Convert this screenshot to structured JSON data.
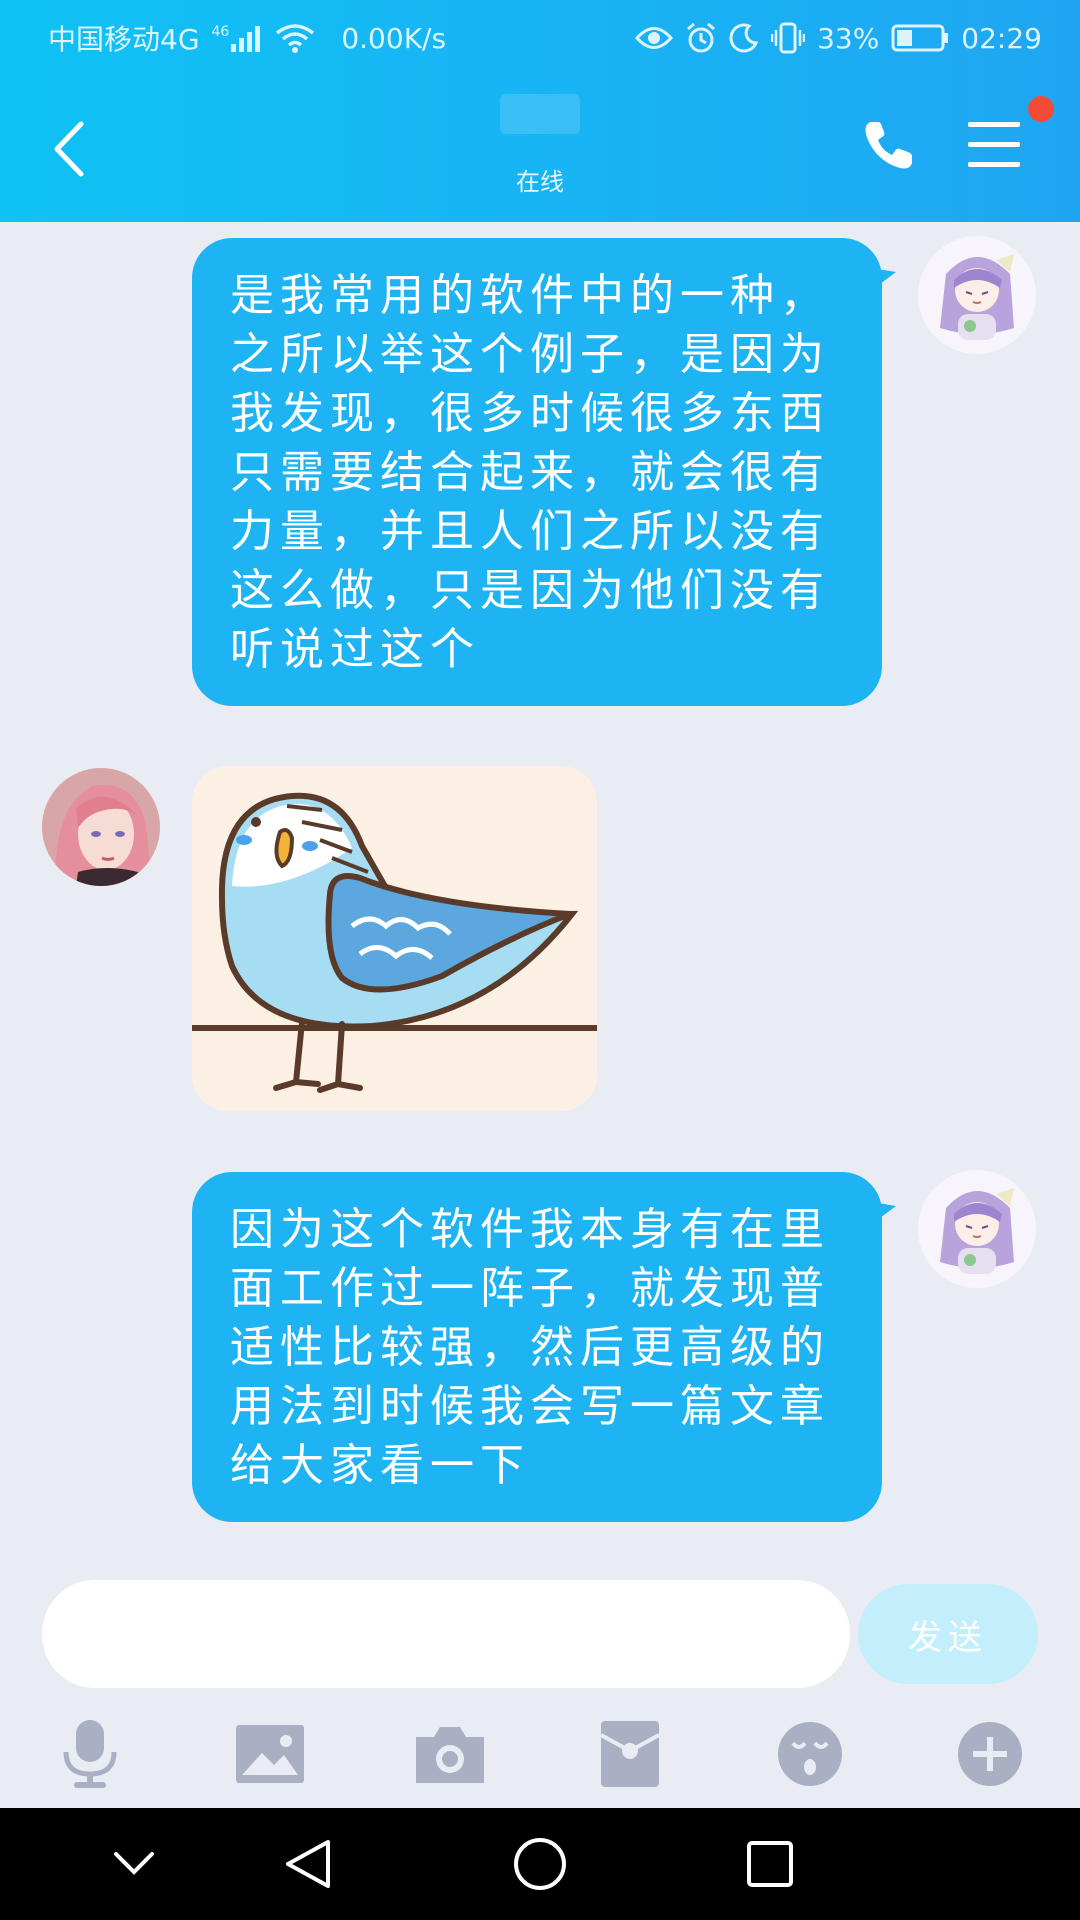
{
  "status_bar": {
    "carrier": "中国移动4G",
    "network_badge": "46",
    "speed": "0.00K/s",
    "battery_percent": "33%",
    "time": "02:29",
    "icons": [
      "signal-icon",
      "wifi-icon",
      "eye-icon",
      "alarm-icon",
      "moon-icon",
      "vibrate-icon",
      "battery-icon"
    ]
  },
  "header": {
    "contact_status": "在线",
    "icons": [
      "back-icon",
      "phone-icon",
      "menu-icon"
    ],
    "has_notification": true
  },
  "messages": [
    {
      "side": "right",
      "type": "text",
      "text": "是我常用的软件中的一种，\n之所以举这个例子，是因为\n我发现，很多时候很多东西\n只需要结合起来，就会很有\n力量，并且人们之所以没有\n这么做，只是因为他们没有\n听说过这个"
    },
    {
      "side": "left",
      "type": "sticker",
      "sticker": "blue-parakeet-sticker"
    },
    {
      "side": "right",
      "type": "text",
      "text": "因为这个软件我本身有在里\n面工作过一阵子，就发现普\n适性比较强，然后更高级的\n用法到时候我会写一篇文章\n给大家看一下"
    }
  ],
  "composer": {
    "input_value": "",
    "send_label": "发送"
  },
  "toolbar": {
    "icons": [
      "microphone-icon",
      "image-icon",
      "camera-icon",
      "red-packet-icon",
      "emoji-icon",
      "plus-icon"
    ]
  },
  "nav_bar": {
    "icons": [
      "chevron-down-icon",
      "back-triangle-icon",
      "home-circle-icon",
      "recents-square-icon"
    ]
  },
  "colors": {
    "header_gradient_start": "#0fc2f5",
    "header_gradient_end": "#1fa6f2",
    "bubble": "#1eb4f4",
    "background": "#e9ecf3",
    "send_button": "#c3eefb",
    "notification": "#f44b36"
  }
}
